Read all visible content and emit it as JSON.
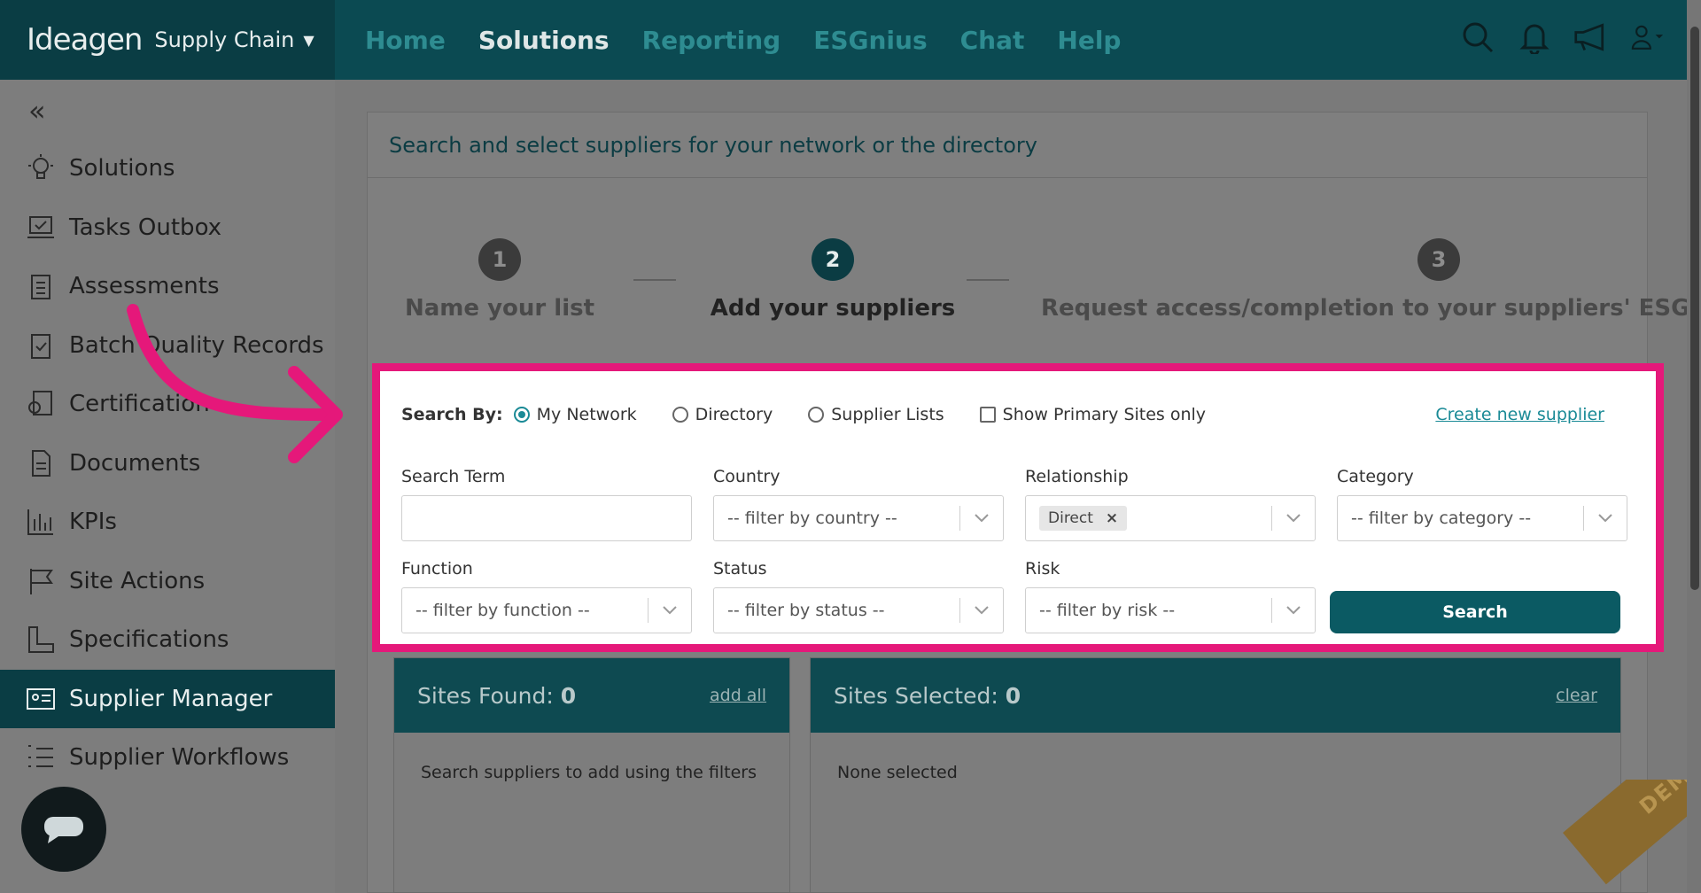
{
  "brand": {
    "logo": "Ideagen",
    "product": "Supply Chain"
  },
  "nav": [
    "Home",
    "Solutions",
    "Reporting",
    "ESGnius",
    "Chat",
    "Help"
  ],
  "nav_active": "Solutions",
  "sidebar": {
    "items": [
      {
        "label": "Solutions",
        "icon": "lightbulb-icon"
      },
      {
        "label": "Tasks Outbox",
        "icon": "laptop-check-icon"
      },
      {
        "label": "Assessments",
        "icon": "clipboard-list-icon"
      },
      {
        "label": "Batch Quality Records",
        "icon": "clipboard-check-icon"
      },
      {
        "label": "Certification",
        "icon": "certificate-icon"
      },
      {
        "label": "Documents",
        "icon": "document-icon"
      },
      {
        "label": "KPIs",
        "icon": "bar-chart-icon"
      },
      {
        "label": "Site Actions",
        "icon": "flag-icon"
      },
      {
        "label": "Specifications",
        "icon": "ruler-icon"
      },
      {
        "label": "Supplier Manager",
        "icon": "id-card-icon",
        "active": true
      },
      {
        "label": "Supplier Workflows",
        "icon": "numbered-list-icon"
      }
    ]
  },
  "page": {
    "heading": "Search and select suppliers for your network or the directory",
    "steps": [
      {
        "num": "1",
        "label": "Name your list"
      },
      {
        "num": "2",
        "label": "Add your suppliers"
      },
      {
        "num": "3",
        "label": "Request access/completion to your suppliers' ESG As"
      }
    ]
  },
  "search": {
    "by_label": "Search By:",
    "options": [
      "My Network",
      "Directory",
      "Supplier Lists"
    ],
    "primary_only": "Show Primary Sites only",
    "create_link": "Create new supplier",
    "fields": {
      "term_label": "Search Term",
      "country_label": "Country",
      "country_ph": "-- filter by country --",
      "relationship_label": "Relationship",
      "relationship_tag": "Direct",
      "category_label": "Category",
      "category_ph": "-- filter by category --",
      "function_label": "Function",
      "function_ph": "-- filter by function --",
      "status_label": "Status",
      "status_ph": "-- filter by status --",
      "risk_label": "Risk",
      "risk_ph": "-- filter by risk --"
    },
    "button": "Search"
  },
  "results": {
    "found_label": "Sites Found: ",
    "found_count": "0",
    "add_all": "add all",
    "found_empty": "Search suppliers to add using the filters",
    "selected_label": "Sites Selected: ",
    "selected_count": "0",
    "clear": "clear",
    "selected_empty": "None selected"
  },
  "demo_ribbon": "DEMO",
  "colors": {
    "highlight": "#e5187a",
    "brand_dark": "#0a3d44",
    "teal": "#1a8a96"
  }
}
